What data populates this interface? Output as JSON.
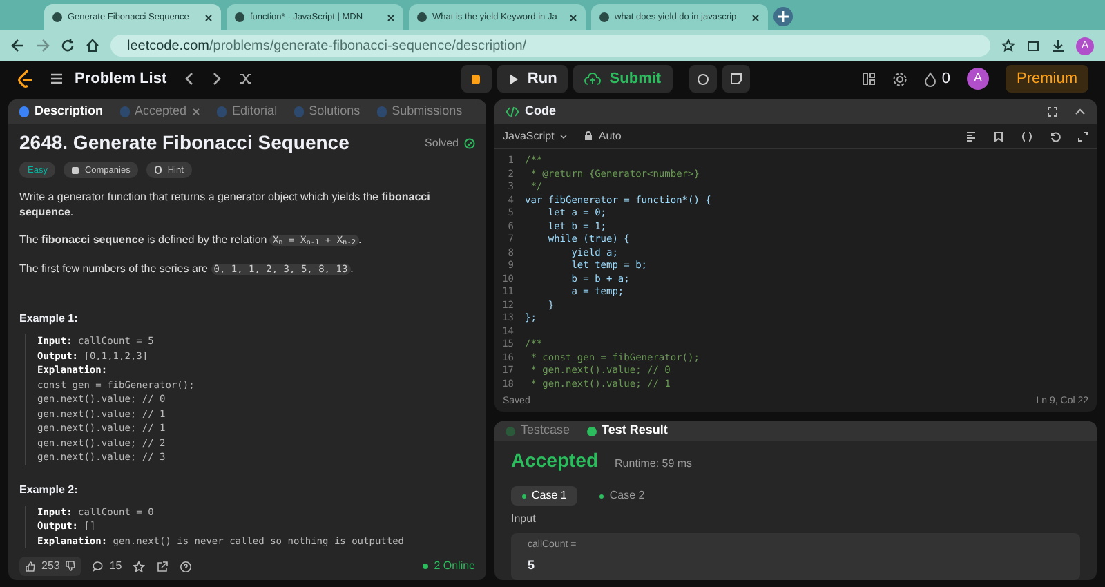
{
  "browser": {
    "tabs": [
      {
        "title": "Generate Fibonacci Sequence",
        "selected": true
      },
      {
        "title": "function* - JavaScript | MDN",
        "selected": false
      },
      {
        "title": "What is the yield Keyword in Ja",
        "selected": false
      },
      {
        "title": "what does yield do in javascrip",
        "selected": false
      }
    ],
    "url_host": "leetcode.com",
    "url_path": "/problems/generate-fibonacci-sequence/description/",
    "profile": "A"
  },
  "navbar": {
    "problem_list": "Problem List",
    "run": "Run",
    "submit": "Submit",
    "streak": "0",
    "avatar": "A",
    "premium": "Premium"
  },
  "left_panel": {
    "tabs": [
      {
        "label": "Description",
        "selected": true,
        "closable": false
      },
      {
        "label": "Accepted",
        "selected": false,
        "closable": true
      },
      {
        "label": "Editorial",
        "selected": false,
        "closable": false
      },
      {
        "label": "Solutions",
        "selected": false,
        "closable": false
      },
      {
        "label": "Submissions",
        "selected": false,
        "closable": false
      }
    ],
    "title": "2648. Generate Fibonacci Sequence",
    "status": "Solved",
    "tags": [
      {
        "label": "Easy",
        "kind": "difficulty"
      },
      {
        "label": "Companies",
        "kind": "companies"
      },
      {
        "label": "Hint",
        "kind": "hint"
      }
    ],
    "paragraphs": [
      {
        "text": "Write a generator function that returns a generator object which yields the **fibonacci sequence**."
      },
      {
        "text": "The **fibonacci sequence** is defined by the relation",
        "code": "X$_{n}$ = X$_{n-1}$ + X$_{n-2}$",
        "after": "."
      },
      {
        "text": "The first few numbers of the series are",
        "code": "0, 1, 1, 2, 3, 5, 8, 13",
        "after": "."
      }
    ],
    "examples": [
      {
        "title": "Example 1:",
        "lines": [
          "**Input:** callCount = 5",
          "**Output:** [0,1,1,2,3]",
          "**Explanation:**",
          "const gen = fibGenerator();",
          "gen.next().value; // 0",
          "gen.next().value; // 1",
          "gen.next().value; // 1",
          "gen.next().value; // 2",
          "gen.next().value; // 3"
        ]
      },
      {
        "title": "Example 2:",
        "lines": [
          "**Input:** callCount = 0",
          "**Output:** []",
          "**Explanation:** gen.next() is never called so nothing is outputted"
        ]
      }
    ],
    "likes": "253",
    "comments": "15",
    "online": "2 Online"
  },
  "code_panel": {
    "title": "Code",
    "language": "JavaScript",
    "mode": "Auto",
    "lines": [
      {
        "number": "1",
        "text": "/**",
        "kind": "comment"
      },
      {
        "number": "2",
        "text": " * @return {Generator<number>}",
        "kind": "comment"
      },
      {
        "number": "3",
        "text": " */",
        "kind": "comment"
      },
      {
        "number": "4",
        "text": "var fibGenerator = function*() {",
        "kind": "code"
      },
      {
        "number": "5",
        "text": "    let a = 0;",
        "kind": "code"
      },
      {
        "number": "6",
        "text": "    let b = 1;",
        "kind": "code"
      },
      {
        "number": "7",
        "text": "    while (true) {",
        "kind": "code"
      },
      {
        "number": "8",
        "text": "        yield a;",
        "kind": "code"
      },
      {
        "number": "9",
        "text": "        let temp = b;",
        "kind": "code"
      },
      {
        "number": "10",
        "text": "        b = b + a;",
        "kind": "code"
      },
      {
        "number": "11",
        "text": "        a = temp;",
        "kind": "code"
      },
      {
        "number": "12",
        "text": "    }",
        "kind": "code"
      },
      {
        "number": "13",
        "text": "};",
        "kind": "code"
      },
      {
        "number": "14",
        "kind": "code"
      },
      {
        "number": "15",
        "text": "/**",
        "kind": "comment"
      },
      {
        "number": "16",
        "text": " * const gen = fibGenerator();",
        "kind": "comment"
      },
      {
        "number": "17",
        "text": " * gen.next().value; // 0",
        "kind": "comment"
      },
      {
        "number": "18",
        "text": " * gen.next().value; // 1",
        "kind": "comment"
      }
    ],
    "saved": "Saved",
    "cursor": "Ln 9, Col 22"
  },
  "result_panel": {
    "tabs": [
      {
        "label": "Testcase",
        "selected": false
      },
      {
        "label": "Test Result",
        "selected": true
      }
    ],
    "verdict": "Accepted",
    "runtime": "Runtime: 59 ms",
    "cases": [
      {
        "label": "Case 1",
        "selected": true
      },
      {
        "label": "Case 2",
        "selected": false
      }
    ],
    "input_label": "Input",
    "param_name": "callCount =",
    "param_value": "5"
  }
}
